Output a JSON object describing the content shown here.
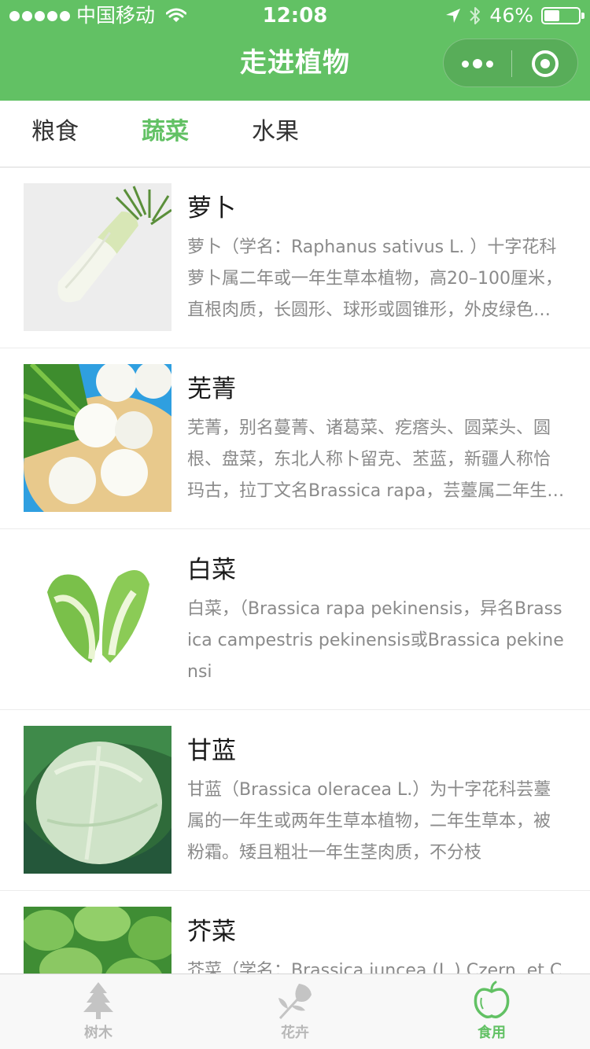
{
  "status_bar": {
    "carrier": "中国移动",
    "time": "12:08",
    "battery": "46%",
    "battery_level": 0.46,
    "signal_icon": "signal-dots-icon",
    "wifi_icon": "wifi-icon",
    "location_icon": "location-arrow-icon",
    "bluetooth_icon": "bluetooth-icon"
  },
  "nav": {
    "title": "走进植物",
    "more_icon": "more-dots-icon",
    "close_icon": "target-close-icon"
  },
  "tabs": [
    {
      "label": "粮食",
      "active": false
    },
    {
      "label": "蔬菜",
      "active": true
    },
    {
      "label": "水果",
      "active": false
    }
  ],
  "items": [
    {
      "title": "萝卜",
      "desc": "萝卜（学名：Raphanus sativus L. ）十字花科萝卜属二年或一年生草本植物，高20–100厘米，直根肉质，长圆形、球形或圆锥形，外皮绿色、白色或红色",
      "image": "radish-image"
    },
    {
      "title": "芜菁",
      "desc": "芜菁，别名蔓菁、诸葛菜、疙瘩头、圆菜头、圆根、盘菜，东北人称卜留克、苤蓝，新疆人称恰玛古，拉丁文名Brassica rapa，芸薹属二年生草本植物",
      "image": "turnip-image"
    },
    {
      "title": "白菜",
      "desc": "白菜，（Brassica rapa pekinensis，异名Brassica campestris pekinensis或Brassica pekinensi",
      "image": "chinese-cabbage-image"
    },
    {
      "title": "甘蓝",
      "desc": "甘蓝（Brassica oleracea L.）为十字花科芸薹属的一年生或两年生草本植物，二年生草本，被粉霜。矮且粗壮一年生茎肉质，不分枝",
      "image": "cabbage-image"
    },
    {
      "title": "芥菜",
      "desc": "芥菜（学名：Brassica juncea (L.) Czern. et Coss.）",
      "image": "mustard-greens-image"
    }
  ],
  "tabbar": [
    {
      "label": "树木",
      "icon": "tree-icon",
      "active": false
    },
    {
      "label": "花卉",
      "icon": "flower-icon",
      "active": false
    },
    {
      "label": "食用",
      "icon": "apple-icon",
      "active": true
    }
  ],
  "colors": {
    "brand": "#62c164",
    "inactive": "#b8b8b8",
    "text": "#1a1a1a",
    "desc": "#8a8a8a"
  }
}
